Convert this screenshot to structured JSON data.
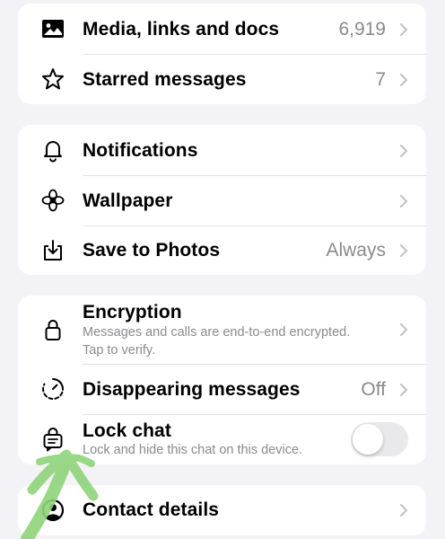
{
  "group1": {
    "media": {
      "label": "Media, links and docs",
      "value": "6,919",
      "icon": "photo-icon"
    },
    "starred": {
      "label": "Starred messages",
      "value": "7",
      "icon": "star-icon"
    }
  },
  "group2": {
    "notifications": {
      "label": "Notifications",
      "icon": "bell-icon"
    },
    "wallpaper": {
      "label": "Wallpaper",
      "icon": "flower-icon"
    },
    "save_photos": {
      "label": "Save to Photos",
      "value": "Always",
      "icon": "download-icon"
    }
  },
  "group3": {
    "encryption": {
      "label": "Encryption",
      "subtitle": "Messages and calls are end-to-end encrypted. Tap to verify.",
      "icon": "lock-icon"
    },
    "disappearing": {
      "label": "Disappearing messages",
      "value": "Off",
      "icon": "timer-icon"
    },
    "lock_chat": {
      "label": "Lock chat",
      "subtitle": "Lock and hide this chat on this device.",
      "toggle_on": false,
      "icon": "chat-lock-icon"
    }
  },
  "group4": {
    "contact": {
      "label": "Contact details",
      "icon": "user-circle-icon"
    }
  },
  "colors": {
    "background": "#f2f2f7",
    "card": "#ffffff",
    "secondary_text": "#8a8a8e",
    "scribble": "#8fd47a"
  }
}
